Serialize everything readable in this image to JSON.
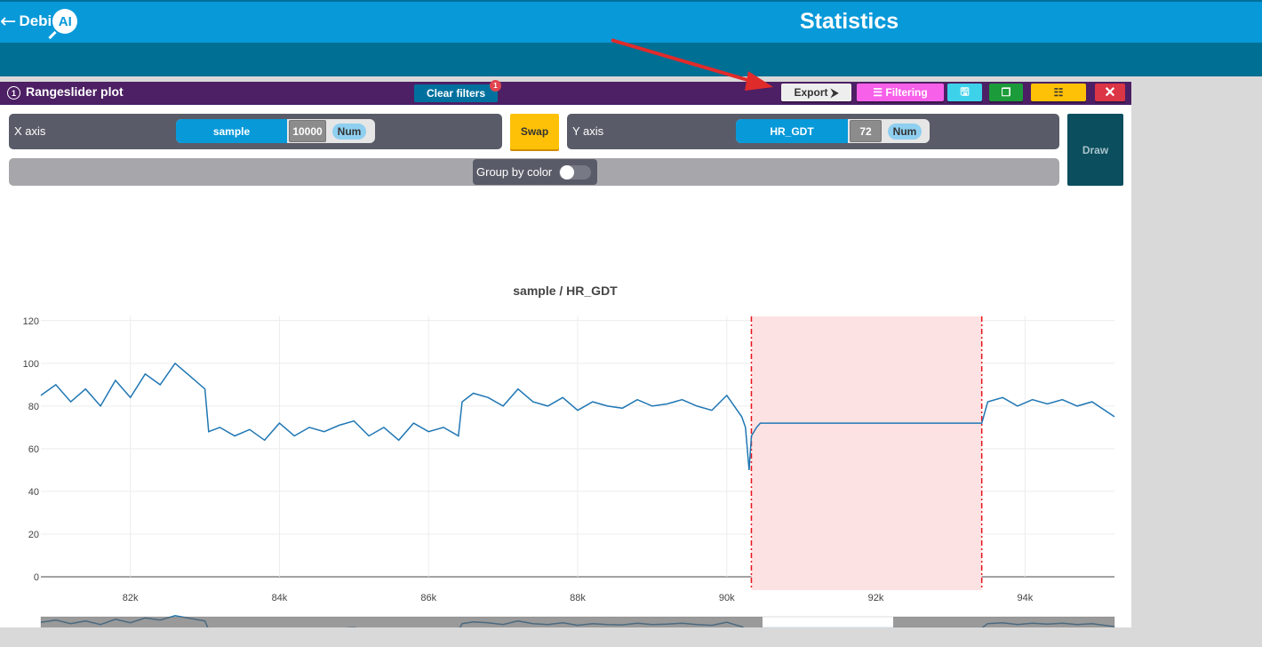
{
  "header": {
    "back_arrow": "←",
    "logo_text": "Debi",
    "logo_badge": "AI",
    "title": "Statistics"
  },
  "panel": {
    "info_icon": "1",
    "title": "Rangeslider plot",
    "clear_filters_label": "Clear filters",
    "clear_filters_badge": "1",
    "export_label": "Export ⮞",
    "filtering_label": "☰ Filtering",
    "save_icon": "🖫",
    "copy_icon": "❐",
    "settings_icon": "☷",
    "close_icon": "✕",
    "x_axis_label": "X axis",
    "x_column": {
      "name": "sample",
      "count": "10000",
      "type": "Num"
    },
    "swap_label": "Swap",
    "y_axis_label": "Y axis",
    "y_column": {
      "name": "HR_GDT",
      "count": "72",
      "type": "Num"
    },
    "draw_label": "Draw",
    "group_by_color_label": "Group by color"
  },
  "colors": {
    "header_blue": "#0899d9",
    "panel_purple": "#4d1f64",
    "line_blue": "#1f77b4",
    "selection_fill": "#fde2e3",
    "selection_line": "#e8141b"
  },
  "chart_data": {
    "type": "line",
    "title": "sample / HR_GDT",
    "xlabel": "",
    "ylabel": "",
    "xlim": [
      80800,
      95200
    ],
    "ylim": [
      0,
      122
    ],
    "x_ticks": [
      "82k",
      "84k",
      "86k",
      "88k",
      "90k",
      "92k",
      "94k"
    ],
    "y_ticks": [
      "0",
      "20",
      "40",
      "60",
      "80",
      "100",
      "120"
    ],
    "selection_range": [
      90330,
      93420
    ],
    "series": [
      {
        "name": "HR_GDT",
        "x": [
          80800,
          81000,
          81200,
          81400,
          81600,
          81800,
          82000,
          82200,
          82400,
          82600,
          82800,
          83000,
          83050,
          83200,
          83400,
          83600,
          83800,
          84000,
          84200,
          84400,
          84600,
          84800,
          85000,
          85200,
          85400,
          85600,
          85800,
          86000,
          86200,
          86400,
          86450,
          86600,
          86800,
          87000,
          87200,
          87400,
          87600,
          87800,
          88000,
          88200,
          88400,
          88600,
          88800,
          89000,
          89200,
          89400,
          89600,
          89800,
          90000,
          90100,
          90200,
          90250,
          90300,
          90330,
          90400,
          90450,
          90500,
          91000,
          91500,
          92000,
          92500,
          93000,
          93420,
          93500,
          93700,
          93900,
          94100,
          94300,
          94500,
          94700,
          94900,
          95200
        ],
        "values": [
          85,
          90,
          82,
          88,
          80,
          92,
          84,
          95,
          90,
          100,
          94,
          88,
          68,
          70,
          66,
          69,
          64,
          72,
          66,
          70,
          68,
          71,
          73,
          66,
          70,
          64,
          72,
          68,
          70,
          66,
          82,
          86,
          84,
          80,
          88,
          82,
          80,
          84,
          78,
          82,
          80,
          79,
          83,
          80,
          81,
          83,
          80,
          78,
          85,
          80,
          75,
          70,
          50,
          66,
          70,
          72,
          72,
          72,
          72,
          72,
          72,
          72,
          72,
          82,
          84,
          80,
          83,
          81,
          83,
          80,
          82,
          75
        ]
      }
    ]
  }
}
